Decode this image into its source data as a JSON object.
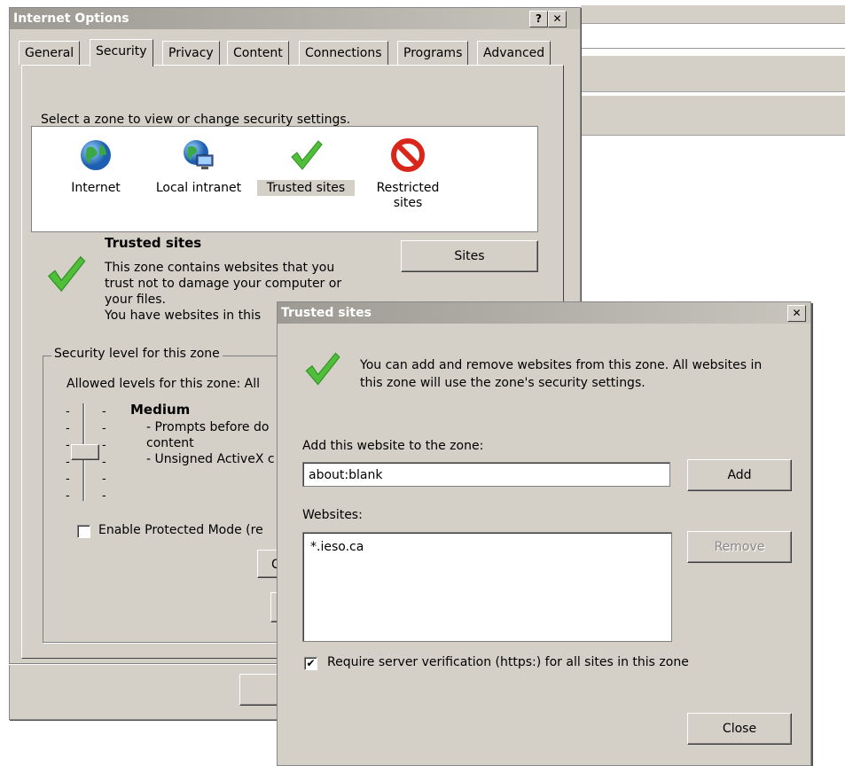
{
  "internet_options": {
    "title": "Internet Options",
    "help_btn": "?",
    "close_btn": "✕",
    "tabs": [
      {
        "label": "General"
      },
      {
        "label": "Security"
      },
      {
        "label": "Privacy"
      },
      {
        "label": "Content"
      },
      {
        "label": "Connections"
      },
      {
        "label": "Programs"
      },
      {
        "label": "Advanced"
      }
    ],
    "active_tab": "Security",
    "zone_prompt": "Select a zone to view or change security settings.",
    "zones": [
      {
        "label": "Internet",
        "icon": "globe-icon"
      },
      {
        "label": "Local intranet",
        "icon": "intranet-icon"
      },
      {
        "label": "Trusted sites",
        "icon": "checkmark-icon"
      },
      {
        "label": "Restricted",
        "label2": "sites",
        "icon": "prohibited-icon"
      }
    ],
    "selected_zone_title": "Trusted sites",
    "zone_desc_lines": [
      "This zone contains websites that you",
      "trust not to damage your computer or",
      "your files.",
      "You have websites in this"
    ],
    "sites_button": "Sites",
    "security_level_legend": "Security level for this zone",
    "allowed_levels": "Allowed levels for this zone: All",
    "level_name": "Medium",
    "level_lines": [
      "- Prompts before do",
      "content",
      "- Unsigned ActiveX c"
    ],
    "protected_mode_label": "Enable Protected Mode (re",
    "custom_btn_partial": "C"
  },
  "trusted_sites": {
    "title": "Trusted sites",
    "close_btn": "✕",
    "info_line1": "You can add and remove websites from this zone. All websites in",
    "info_line2": "this zone will use the zone's security settings.",
    "add_label": "Add this website to the zone:",
    "add_value": "about:blank",
    "add_button": "Add",
    "websites_label": "Websites:",
    "websites": [
      "*.ieso.ca"
    ],
    "remove_button": "Remove",
    "require_https_label": "Require server verification (https:) for all sites in this zone",
    "require_https_checked": true,
    "close_button": "Close"
  },
  "colors": {
    "dialog_bg": "#d4d0c8",
    "titlebar": "#9c9a93",
    "check_green": "#4fbf3a",
    "prohibit_red": "#d8261a"
  }
}
